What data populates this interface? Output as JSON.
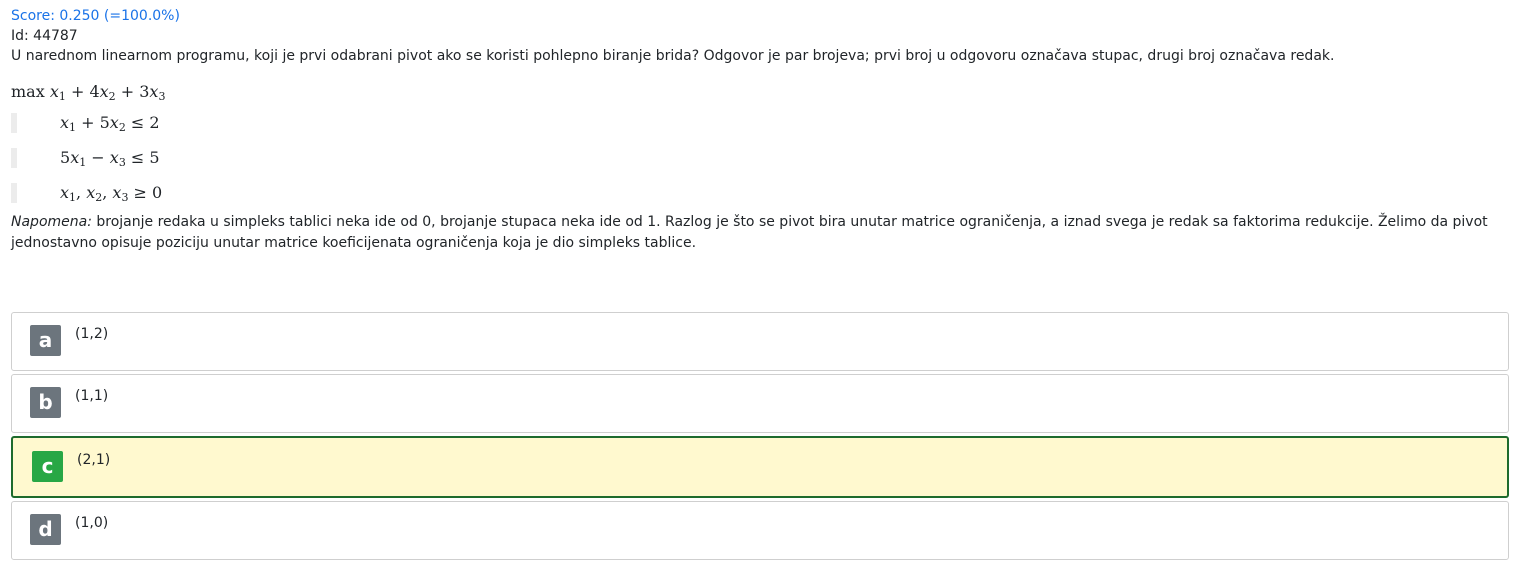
{
  "header": {
    "score": "Score: 0.250 (=100.0%)",
    "id": "Id: 44787"
  },
  "question": {
    "text": "U narednom linearnom programu, koji je prvi odabrani pivot ako se koristi pohlepno biranje brida? Odgovor je par brojeva; prvi broj u odgovoru označava stupac, drugi broj označava redak."
  },
  "lp": {
    "max": "max",
    "obj_t1": "x",
    "obj_t1_sub": "1",
    "obj_op1": " + 4",
    "obj_t2": "x",
    "obj_t2_sub": "2",
    "obj_op2": " + 3",
    "obj_t3": "x",
    "obj_t3_sub": "3",
    "c1": {
      "a": "x",
      "a_sub": "1",
      "op": " + 5",
      "b": "x",
      "b_sub": "2",
      "rel": " ≤ 2"
    },
    "c2": {
      "coef": "5",
      "a": "x",
      "a_sub": "1",
      "op": " − ",
      "b": "x",
      "b_sub": "3",
      "rel": " ≤ 5"
    },
    "c3": {
      "a": "x",
      "a_sub": "1",
      "s1": ", ",
      "b": "x",
      "b_sub": "2",
      "s2": ", ",
      "c": "x",
      "c_sub": "3",
      "rel": " ≥ 0"
    }
  },
  "note": {
    "label": "Napomena:",
    "text": " brojanje redaka u simpleks tablici neka ide od 0, brojanje stupaca neka ide od 1. Razlog je što se pivot bira unutar matrice ograničenja, a iznad svega je redak sa faktorima redukcije. Želimo da pivot jednostavno opisuje poziciju unutar matrice koeficijenata ograničenja koja je dio simpleks tablice."
  },
  "answers": [
    {
      "letter": "a",
      "text": "(1,2)"
    },
    {
      "letter": "b",
      "text": "(1,1)"
    },
    {
      "letter": "c",
      "text": "(2,1)",
      "selected": true
    },
    {
      "letter": "d",
      "text": "(1,0)"
    }
  ],
  "colors": {
    "score": "#1a73e8",
    "selected_border": "#1e6b2d",
    "selected_bg": "#fff9cf",
    "selected_letter": "#28a745",
    "letter_bg": "#6c757d"
  }
}
